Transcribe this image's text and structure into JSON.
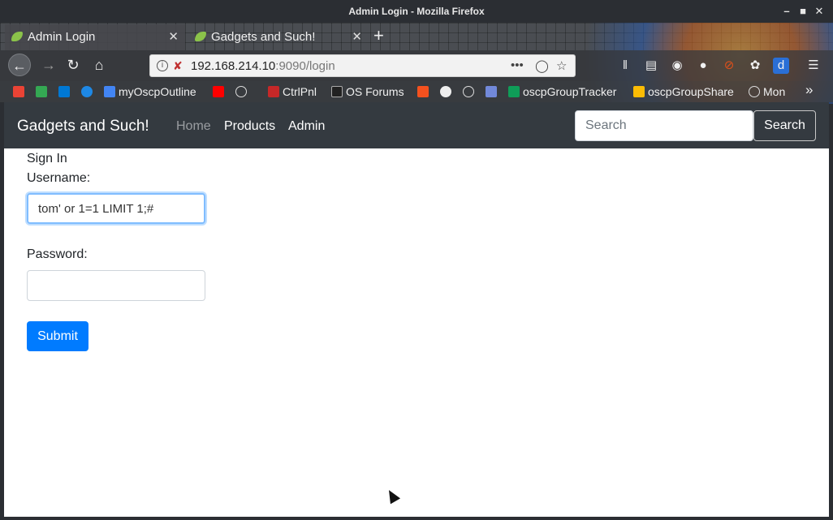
{
  "window": {
    "title": "Admin Login - Mozilla Firefox"
  },
  "tabs": [
    {
      "label": "Admin Login"
    },
    {
      "label": "Gadgets and Such!"
    }
  ],
  "url": {
    "host": "192.168.214.10",
    "rest": ":9090/login"
  },
  "bookmarks": [
    {
      "label": "myOscpOutline"
    },
    {
      "label": "CtrlPnl"
    },
    {
      "label": "OS Forums"
    },
    {
      "label": "oscpGroupTracker"
    },
    {
      "label": "oscpGroupShare"
    },
    {
      "label": "Mon"
    }
  ],
  "site": {
    "brand": "Gadgets and Such!",
    "nav": [
      "Home",
      "Products",
      "Admin"
    ],
    "search_placeholder": "Search",
    "search_button": "Search"
  },
  "form": {
    "heading": "Sign In",
    "username_label": "Username:",
    "username_value": "tom' or 1=1 LIMIT 1;#",
    "password_label": "Password:",
    "password_value": "",
    "submit_label": "Submit"
  },
  "colors": {
    "primary": "#007bff",
    "navbar": "#343a40"
  }
}
